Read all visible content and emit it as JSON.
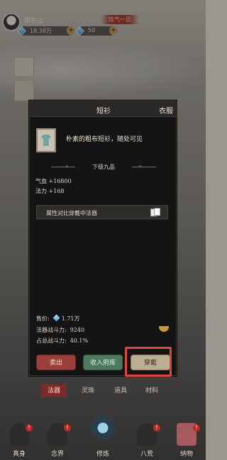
{
  "player": {
    "name": "邵东山",
    "realm": "炼气一层"
  },
  "resources": [
    {
      "icon": "spirit-stone-icon",
      "value": "18.38万",
      "color": "#3d9ad6"
    },
    {
      "icon": "spirit-stone-icon",
      "value": "50",
      "color": "#3d9ad6"
    }
  ],
  "dialog": {
    "title": "短衫",
    "category": "衣服",
    "description": "朴素的粗布短衫，随处可见",
    "grade": "下级九品",
    "stats": [
      "气血 +16800",
      "法力 +168"
    ],
    "compare_label": "属性对比穿戴中法器",
    "price_label": "售价:",
    "price_value": "1.71万",
    "power_label": "法器战斗力:",
    "power_value": "9240",
    "share_label": "占总战斗力:",
    "share_value": "40.1%",
    "buttons": {
      "sell": "卖出",
      "store": "收入府库",
      "wear": "穿戴"
    }
  },
  "tabs": [
    {
      "label": "法器",
      "active": true
    },
    {
      "label": "灵珠",
      "active": false
    },
    {
      "label": "道具",
      "active": false
    },
    {
      "label": "材料",
      "active": false
    }
  ],
  "bottom_nav": [
    {
      "label": "真身",
      "alert": "!"
    },
    {
      "label": "念界",
      "alert": "!"
    },
    {
      "label": "修炼",
      "alert": ""
    },
    {
      "label": "八荒",
      "alert": "!"
    },
    {
      "label": "纳物",
      "alert": "!"
    }
  ],
  "colors": {
    "sell": "#9b3f3a",
    "store": "#4d7a5e",
    "wear": "#bcae93",
    "highlight": "#e2433e",
    "active_tab": "#7c2b28"
  }
}
